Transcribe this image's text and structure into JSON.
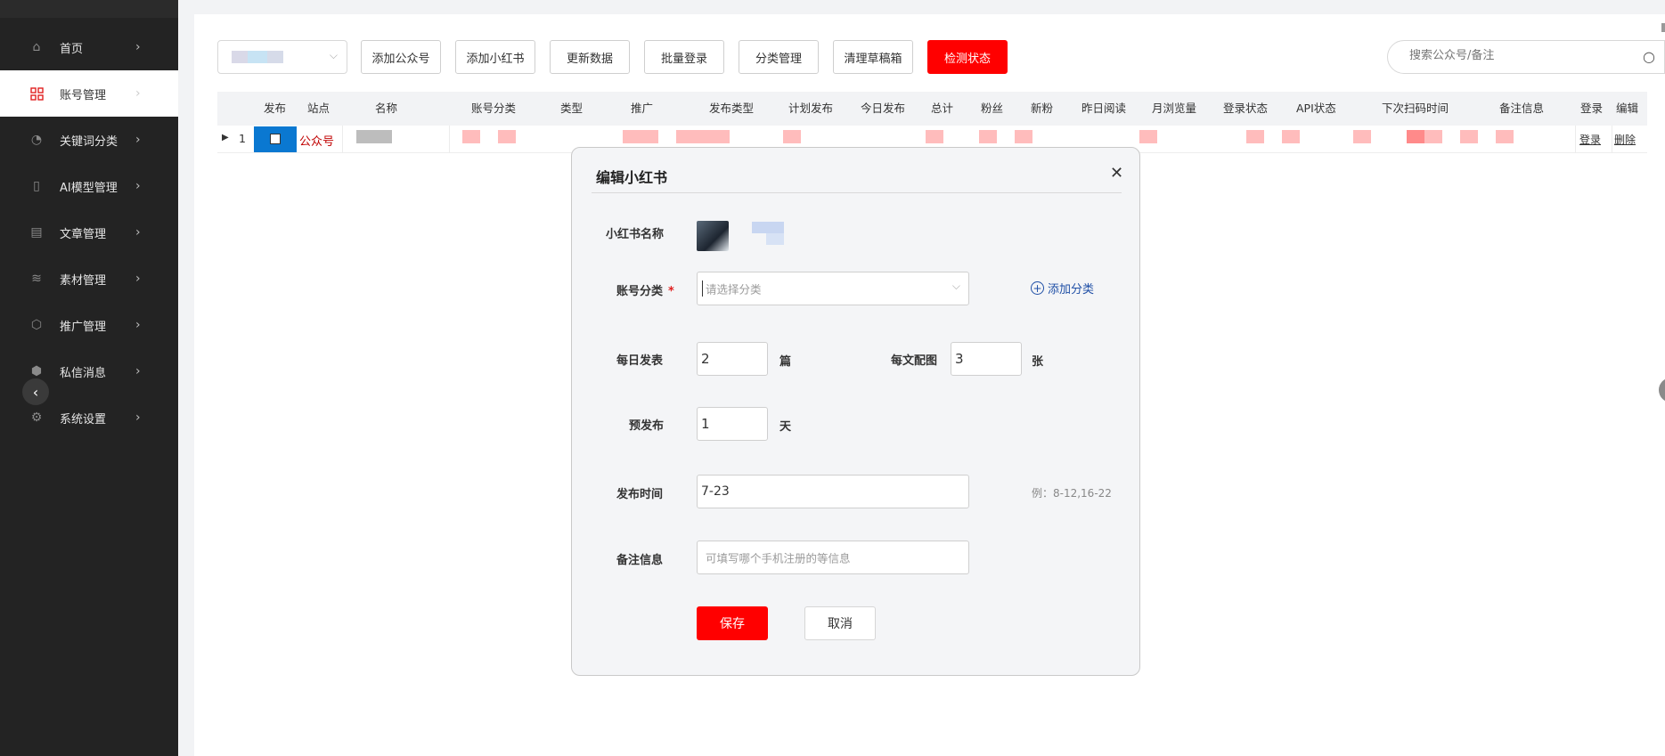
{
  "sidebar": {
    "items": [
      {
        "label": "首页",
        "icon": "home-icon"
      },
      {
        "label": "账号管理",
        "icon": "grid-icon",
        "active": true
      },
      {
        "label": "关键词分类",
        "icon": "trend-icon"
      },
      {
        "label": "AI模型管理",
        "icon": "book-icon"
      },
      {
        "label": "文章管理",
        "icon": "document-icon"
      },
      {
        "label": "素材管理",
        "icon": "database-icon"
      },
      {
        "label": "推广管理",
        "icon": "shield-icon"
      },
      {
        "label": "私信消息",
        "icon": "message-icon"
      },
      {
        "label": "系统设置",
        "icon": "gear-icon"
      }
    ]
  },
  "toolbar": {
    "buttons": [
      "添加公众号",
      "添加小红书",
      "更新数据",
      "批量登录",
      "分类管理",
      "清理草稿箱",
      "检测状态"
    ],
    "search_placeholder": "搜索公众号/备注"
  },
  "table": {
    "columns": [
      "发布",
      "站点",
      "名称",
      "账号分类",
      "类型",
      "推广",
      "发布类型",
      "计划发布",
      "今日发布",
      "总计",
      "粉丝",
      "新粉",
      "昨日阅读",
      "月浏览量",
      "登录状态",
      "API状态",
      "下次扫码时间",
      "备注信息",
      "登录",
      "编辑"
    ],
    "rows": [
      {
        "index": "1",
        "site": "公众号",
        "login_link": "登录",
        "delete_link": "删除"
      }
    ]
  },
  "modal": {
    "title": "编辑小红书",
    "name_label": "小红书名称",
    "category_label": "账号分类",
    "category_placeholder": "请选择分类",
    "add_category": "添加分类",
    "daily_label": "每日发表",
    "daily_value": "2",
    "daily_unit": "篇",
    "images_label": "每文配图",
    "images_value": "3",
    "images_unit": "张",
    "prepublish_label": "预发布",
    "prepublish_value": "1",
    "prepublish_unit": "天",
    "time_label": "发布时间",
    "time_value": "7-23",
    "time_hint": "例：8-12,16-22",
    "remark_label": "备注信息",
    "remark_placeholder": "可填写哪个手机注册的等信息",
    "save": "保存",
    "cancel": "取消"
  },
  "colors": {
    "accent": "#ff0000",
    "sidebar_bg": "#232323",
    "link_blue": "#1f4fa6",
    "publish_cell": "#0a78d1"
  }
}
